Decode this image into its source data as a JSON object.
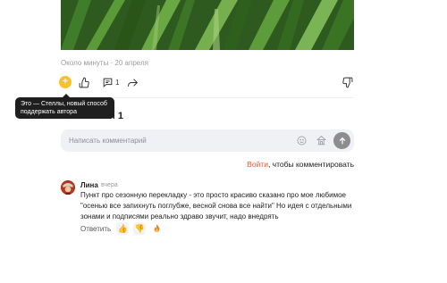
{
  "article": {
    "meta": "Около минуты · 20 апреля",
    "comments_count_label": "1"
  },
  "tooltip": {
    "text": "Это — Стеллы, новый способ поддержать автора"
  },
  "comments": {
    "title_visible": "и 1",
    "input_placeholder": "Написать комментарий",
    "login_link": "Войти",
    "login_suffix": ", чтобы комментировать",
    "items": [
      {
        "author": "Лина",
        "date": "вчера",
        "text": "Пункт про сезонную перекладку - это просто красиво сказано про мое любимое \"осенью все запихнуть поглубже, весной снова все найти\" Но идея с отдельными зонами и подписями реально здраво звучит, надо внедрять",
        "reply_label": "Ответить"
      }
    ]
  },
  "icons": {
    "star": "star-icon",
    "like": "thumbs-up-icon",
    "comment": "comment-icon",
    "share": "share-icon",
    "dislike": "thumbs-down-icon",
    "emoji": "emoji-icon",
    "sticker": "sticker-icon",
    "send": "send-arrow-icon",
    "reaction_like": "thumbs-up-emoji-icon",
    "reaction_dislike": "thumbs-down-emoji-icon",
    "reaction_fire": "fire-emoji-icon"
  },
  "colors": {
    "accent": "#f0522e",
    "star": "#f5c32c",
    "tooltip_bg": "#1f1f1f",
    "input_bg": "#f0f1f4"
  }
}
